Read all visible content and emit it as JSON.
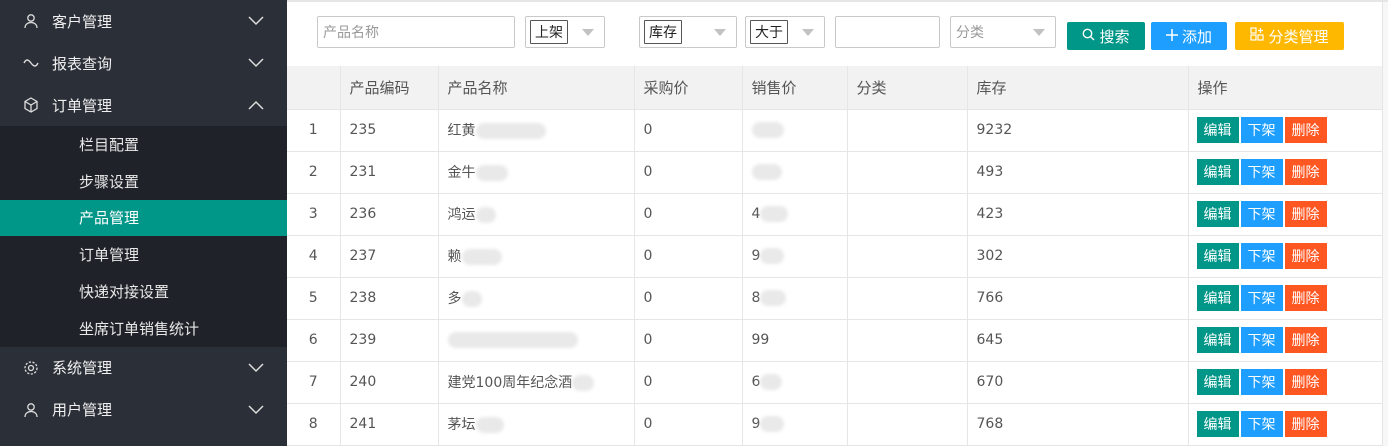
{
  "sidebar": {
    "groups": [
      {
        "label": "客户管理",
        "icon": "user-icon",
        "expanded": false
      },
      {
        "label": "报表查询",
        "icon": "link-icon",
        "expanded": false
      },
      {
        "label": "订单管理",
        "icon": "cube-icon",
        "expanded": true,
        "items": [
          {
            "label": "栏目配置"
          },
          {
            "label": "步骤设置"
          },
          {
            "label": "产品管理",
            "active": true
          },
          {
            "label": "订单管理"
          },
          {
            "label": "快递对接设置"
          },
          {
            "label": "坐席订单销售统计"
          }
        ]
      },
      {
        "label": "系统管理",
        "icon": "gear-icon",
        "expanded": false
      },
      {
        "label": "用户管理",
        "icon": "user-icon",
        "expanded": false
      }
    ]
  },
  "toolbar": {
    "product_name_placeholder": "产品名称",
    "status_select": "上架",
    "stock_select": "库存",
    "compare_select": "大于",
    "stock_value": "",
    "category_placeholder": "分类",
    "search_label": "搜索",
    "add_label": "添加",
    "category_manage_label": "分类管理"
  },
  "table": {
    "headers": [
      "",
      "产品编码",
      "产品名称",
      "采购价",
      "销售价",
      "分类",
      "库存",
      "操作"
    ],
    "actions": {
      "edit": "编辑",
      "off": "下架",
      "delete": "删除"
    },
    "rows": [
      {
        "idx": "1",
        "code": "235",
        "name": "红黄",
        "purchase": "0",
        "sale": "",
        "category": "",
        "stock": "9232"
      },
      {
        "idx": "2",
        "code": "231",
        "name": "金牛",
        "purchase": "0",
        "sale": "",
        "category": "",
        "stock": "493"
      },
      {
        "idx": "3",
        "code": "236",
        "name": "鸿运",
        "purchase": "0",
        "sale": "4",
        "category": "",
        "stock": "423"
      },
      {
        "idx": "4",
        "code": "237",
        "name": "赖",
        "purchase": "0",
        "sale": "9",
        "category": "",
        "stock": "302"
      },
      {
        "idx": "5",
        "code": "238",
        "name": "多",
        "purchase": "0",
        "sale": "8",
        "category": "",
        "stock": "766"
      },
      {
        "idx": "6",
        "code": "239",
        "name": "",
        "purchase": "0",
        "sale": "99",
        "category": "",
        "stock": "645"
      },
      {
        "idx": "7",
        "code": "240",
        "name": "建党100周年纪念酒",
        "purchase": "0",
        "sale": "6",
        "category": "",
        "stock": "670"
      },
      {
        "idx": "8",
        "code": "241",
        "name": "茅坛",
        "purchase": "0",
        "sale": "9",
        "category": "",
        "stock": "768"
      }
    ]
  },
  "colors": {
    "sidebar_bg": "#2b2f38",
    "active": "#009688",
    "blue": "#1e9fff",
    "yellow": "#ffb800",
    "red": "#ff5722"
  }
}
